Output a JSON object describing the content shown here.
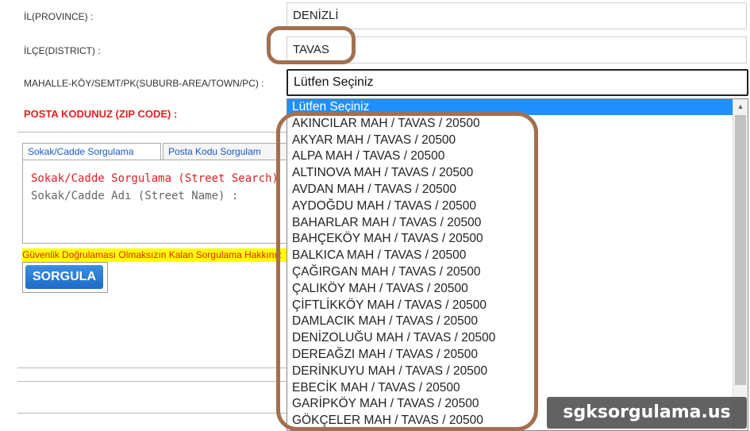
{
  "form": {
    "province_label": "İL(PROVINCE) :",
    "province_value": "DENİZLİ",
    "district_label": "İLÇE(DISTRICT) :",
    "district_value": "TAVAS",
    "suburb_label": "MAHALLE-KÖY/SEMT/PK(SUBURB-AREA/TOWN/PC) :",
    "suburb_selected": "Lütfen Seçiniz",
    "zip_label": "POSTA KODUNUZ (ZIP CODE) :"
  },
  "tabs": [
    {
      "label": "Sokak/Cadde Sorgulama"
    },
    {
      "label": "Posta Kodu Sorgulam"
    }
  ],
  "panel": {
    "title": "Sokak/Cadde Sorgulama (Street Search)",
    "street_label": "Sokak/Cadde Adı (Street Name) :"
  },
  "warning": "Güvenlik Doğrulaması Olmaksızın Kalan Sorgulama Hakkınız",
  "query_button": "SORGULA",
  "dropdown": {
    "options": [
      "Lütfen Seçiniz",
      "AKINCILAR MAH / TAVAS / 20500",
      "AKYAR MAH / TAVAS / 20500",
      "ALPA MAH / TAVAS / 20500",
      "ALTINOVA MAH / TAVAS / 20500",
      "AVDAN MAH / TAVAS / 20500",
      "AYDOĞDU MAH / TAVAS / 20500",
      "BAHARLAR MAH / TAVAS / 20500",
      "BAHÇEKÖY MAH / TAVAS / 20500",
      "BALKICA MAH / TAVAS / 20500",
      "ÇAĞIRGAN MAH / TAVAS / 20500",
      "ÇALIKÖY MAH / TAVAS / 20500",
      "ÇİFTLİKKÖY MAH / TAVAS / 20500",
      "DAMLACIK MAH / TAVAS / 20500",
      "DENİZOLUĞU MAH / TAVAS / 20500",
      "DEREAĞZI MAH / TAVAS / 20500",
      "DERİNKUYU MAH / TAVAS / 20500",
      "EBECİK MAH / TAVAS / 20500",
      "GARİPKÖY MAH / TAVAS / 20500",
      "GÖKÇELER MAH / TAVAS / 20500"
    ]
  },
  "watermark": "sgksorgulama.us",
  "colors": {
    "highlight": "#1e90ff",
    "annotation": "#a2704e",
    "error": "#e02020",
    "button": "#1d6ac8"
  }
}
